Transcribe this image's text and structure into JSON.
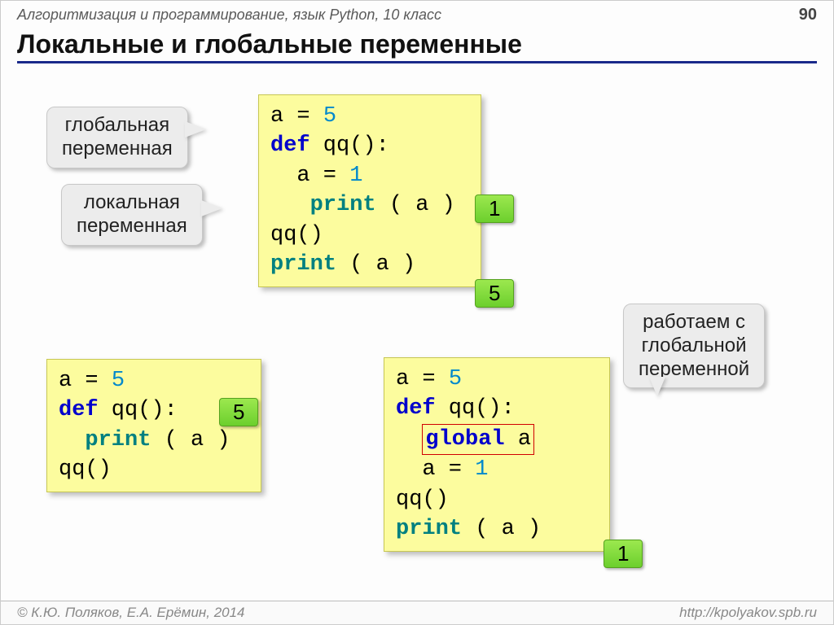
{
  "header": {
    "course": "Алгоритмизация и программирование, язык Python, 10 класс",
    "page": "90"
  },
  "title": "Локальные и глобальные переменные",
  "callouts": {
    "global_var": {
      "l1": "глобальная",
      "l2": "переменная"
    },
    "local_var": {
      "l1": "локальная",
      "l2": "переменная"
    },
    "working": {
      "l1": "работаем с",
      "l2": "глобальной",
      "l3": "переменной"
    }
  },
  "code1": {
    "l1a": "a",
    "l1b": " = ",
    "l1c": "5",
    "l2a": "def",
    "l2b": " qq():",
    "l3a": "  a",
    "l3b": " = ",
    "l3c": "1",
    "l4a": "   ",
    "l4b": "print",
    "l4c": " ( a )",
    "l5": "qq()",
    "l6a": "print",
    "l6b": " ( a )"
  },
  "code2": {
    "l1a": "a",
    "l1b": " = ",
    "l1c": "5",
    "l2a": "def",
    "l2b": " qq():",
    "l3a": "  ",
    "l3b": "print",
    "l3c": " ( a )",
    "l4": "qq()"
  },
  "code3": {
    "l1a": "a",
    "l1b": " = ",
    "l1c": "5",
    "l2a": "def",
    "l2b": " qq():",
    "l3a": "  ",
    "l3b": "global",
    "l3c": " a",
    "l4a": "  a",
    "l4b": " = ",
    "l4c": "1",
    "l5": "qq()",
    "l6a": "print",
    "l6b": " ( a )"
  },
  "badges": {
    "b1": "1",
    "b2": "5",
    "b5": "5",
    "b6": "1"
  },
  "footer": {
    "left": "© К.Ю. Поляков, Е.А. Ерёмин, 2014",
    "right": "http://kpolyakov.spb.ru"
  }
}
